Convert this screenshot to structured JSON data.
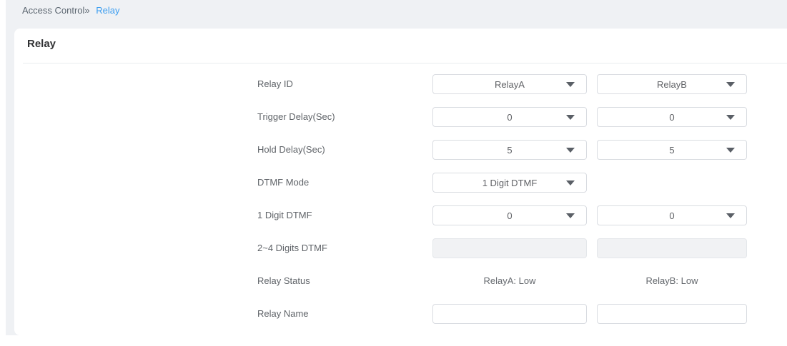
{
  "breadcrumb": {
    "section": "Access Control»",
    "current": "Relay"
  },
  "panel": {
    "title": "Relay"
  },
  "form": {
    "relay_id": {
      "label": "Relay ID",
      "a": "RelayA",
      "b": "RelayB"
    },
    "trigger_delay": {
      "label": "Trigger Delay(Sec)",
      "a": "0",
      "b": "0"
    },
    "hold_delay": {
      "label": "Hold Delay(Sec)",
      "a": "5",
      "b": "5"
    },
    "dtmf_mode": {
      "label": "DTMF Mode",
      "a": "1 Digit DTMF"
    },
    "one_digit_dtmf": {
      "label": "1 Digit DTMF",
      "a": "0",
      "b": "0"
    },
    "multi_digit_dtmf": {
      "label": "2~4 Digits DTMF",
      "a": "",
      "b": ""
    },
    "relay_status": {
      "label": "Relay Status",
      "a": "RelayA: Low",
      "b": "RelayB: Low"
    },
    "relay_name": {
      "label": "Relay Name",
      "a": "",
      "b": ""
    }
  },
  "colors": {
    "accent_blue": "#3d9ef0",
    "page_bg": "#eff1f4",
    "panel_bg": "#ffffff",
    "control_border": "#d9dce1",
    "disabled_bg": "#f1f2f4",
    "label_text": "#5f6368"
  }
}
